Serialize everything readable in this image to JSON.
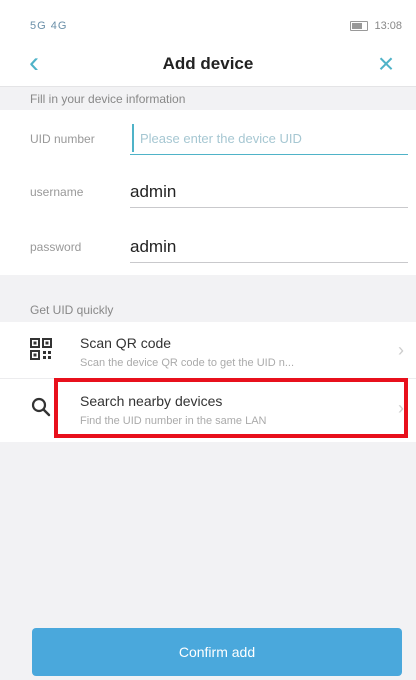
{
  "status_bar": {
    "left": "5G 4G",
    "time": "13:08"
  },
  "header": {
    "title": "Add device"
  },
  "form": {
    "section_label": "Fill in your device information",
    "uid_label": "UID number",
    "uid_placeholder": "Please enter the device UID",
    "username_label": "username",
    "username_value": "admin",
    "password_label": "password",
    "password_value": "admin"
  },
  "quick": {
    "section_label": "Get UID quickly",
    "items": [
      {
        "title": "Scan QR code",
        "subtitle": "Scan the device QR code to get the UID n...",
        "icon": "qr-code-icon"
      },
      {
        "title": "Search nearby devices",
        "subtitle": "Find the UID number in the same LAN",
        "icon": "search-icon"
      }
    ]
  },
  "footer": {
    "confirm_label": "Confirm add"
  },
  "colors": {
    "accent": "#4fb3c8",
    "button": "#4aa8dc",
    "highlight": "#e8101c"
  }
}
